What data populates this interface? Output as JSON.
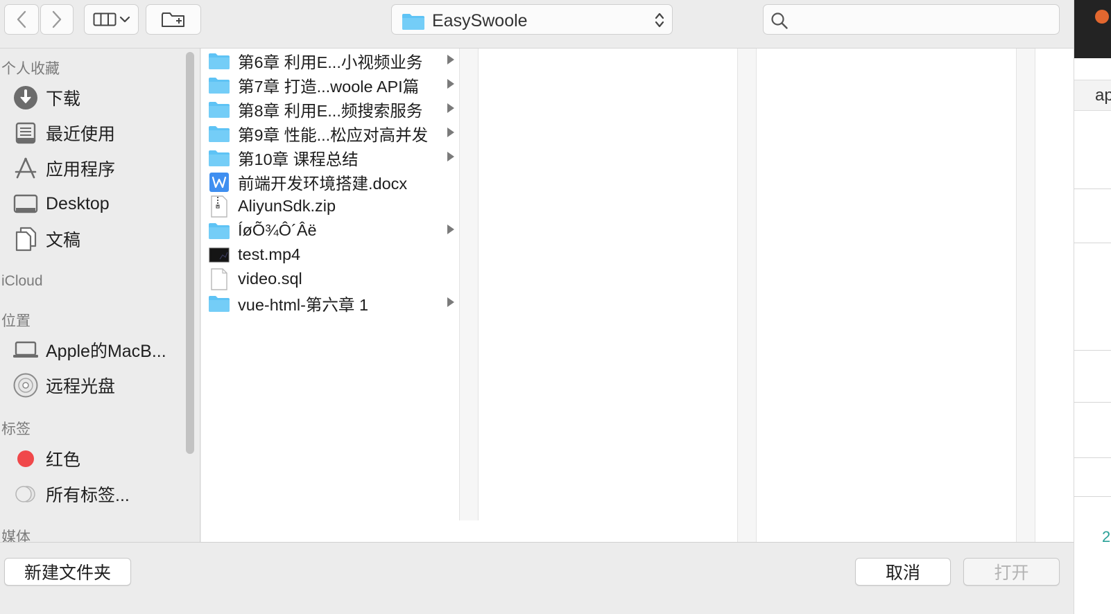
{
  "toolbar": {
    "path_label": "EasySwoole",
    "search_placeholder": ""
  },
  "sidebar": {
    "favorites_header": "个人收藏",
    "favorites": [
      {
        "label": "下载",
        "icon": "download-icon"
      },
      {
        "label": "最近使用",
        "icon": "recents-icon"
      },
      {
        "label": "应用程序",
        "icon": "applications-icon"
      },
      {
        "label": "Desktop",
        "icon": "desktop-icon"
      },
      {
        "label": "文稿",
        "icon": "documents-icon"
      }
    ],
    "icloud_header": "iCloud",
    "locations_header": "位置",
    "locations": [
      {
        "label": "Apple的MacB...",
        "icon": "laptop-icon"
      },
      {
        "label": "远程光盘",
        "icon": "disc-icon"
      }
    ],
    "tags_header": "标签",
    "tags": [
      {
        "label": "红色",
        "color": "#f0484a"
      },
      {
        "label": "所有标签...",
        "color": "#d9d9d9"
      }
    ],
    "media_header": "媒体"
  },
  "files": [
    {
      "name": "第6章 利用E...小视频业务",
      "type": "folder",
      "has_children": true
    },
    {
      "name": "第7章 打造...woole API篇",
      "type": "folder",
      "has_children": true
    },
    {
      "name": "第8章 利用E...频搜索服务",
      "type": "folder",
      "has_children": true
    },
    {
      "name": "第9章 性能...松应对高并发",
      "type": "folder",
      "has_children": true
    },
    {
      "name": "第10章 课程总结",
      "type": "folder",
      "has_children": true
    },
    {
      "name": "前端开发环境搭建.docx",
      "type": "word",
      "has_children": false
    },
    {
      "name": "AliyunSdk.zip",
      "type": "zip",
      "has_children": false
    },
    {
      "name": "ÍøÕ¾Ô´Âë",
      "type": "folder",
      "has_children": true
    },
    {
      "name": "test.mp4",
      "type": "video",
      "has_children": false
    },
    {
      "name": "video.sql",
      "type": "file",
      "has_children": false
    },
    {
      "name": "vue-html-第六章 1",
      "type": "folder",
      "has_children": true
    }
  ],
  "bottom": {
    "new_folder_label": "新建文件夹",
    "cancel_label": "取消",
    "open_label": "打开"
  },
  "background": {
    "snippet_text": "ap",
    "green_text": "2"
  },
  "colors": {
    "folder_blue": "#5ec3f5",
    "word_blue": "#3f8ff0",
    "red_tag": "#f0484a"
  }
}
